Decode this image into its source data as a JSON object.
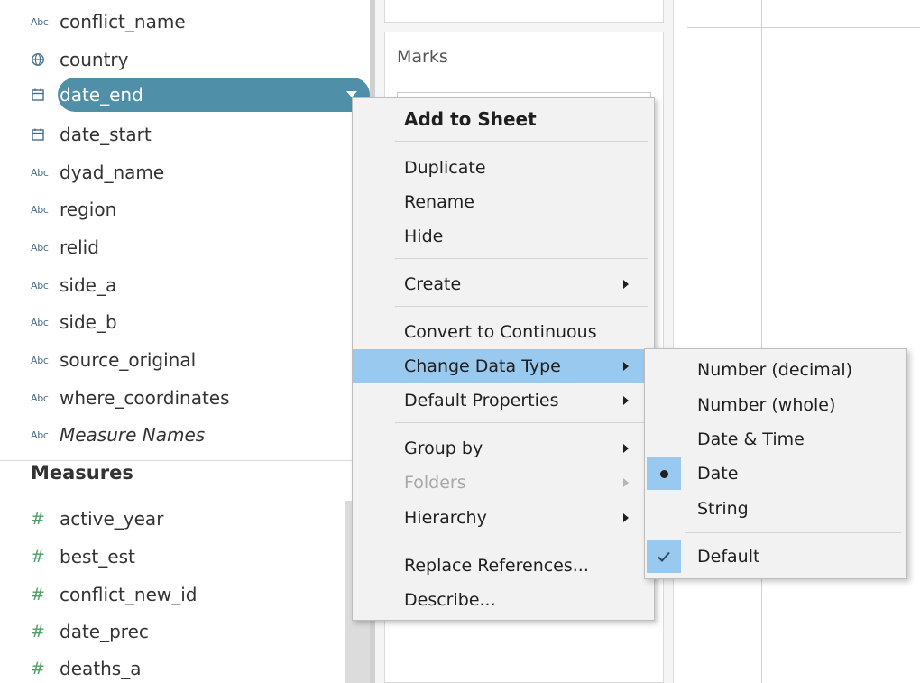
{
  "data_pane": {
    "dimensions": [
      {
        "icon": "abc-icon",
        "glyph": "Abc",
        "label": "conflict_name"
      },
      {
        "icon": "globe-icon",
        "glyph": "",
        "label": "country"
      },
      {
        "icon": "calendar-icon",
        "glyph": "",
        "label": "date_end",
        "selected": true
      },
      {
        "icon": "calendar-icon",
        "glyph": "",
        "label": "date_start"
      },
      {
        "icon": "abc-icon",
        "glyph": "Abc",
        "label": "dyad_name"
      },
      {
        "icon": "abc-icon",
        "glyph": "Abc",
        "label": "region"
      },
      {
        "icon": "abc-icon",
        "glyph": "Abc",
        "label": "relid"
      },
      {
        "icon": "abc-icon",
        "glyph": "Abc",
        "label": "side_a"
      },
      {
        "icon": "abc-icon",
        "glyph": "Abc",
        "label": "side_b"
      },
      {
        "icon": "abc-icon",
        "glyph": "Abc",
        "label": "source_original"
      },
      {
        "icon": "abc-icon",
        "glyph": "Abc",
        "label": "where_coordinates"
      },
      {
        "icon": "abc-icon",
        "glyph": "Abc",
        "label": "Measure Names",
        "italic": true
      }
    ],
    "measures_title": "Measures",
    "measures": [
      {
        "icon": "hash-icon",
        "glyph": "#",
        "label": "active_year"
      },
      {
        "icon": "hash-icon",
        "glyph": "#",
        "label": "best_est"
      },
      {
        "icon": "hash-icon",
        "glyph": "#",
        "label": "conflict_new_id"
      },
      {
        "icon": "hash-icon",
        "glyph": "#",
        "label": "date_prec"
      },
      {
        "icon": "hash-icon",
        "glyph": "#",
        "label": "deaths_a"
      }
    ]
  },
  "marks_card": {
    "title": "Marks"
  },
  "context_menu": {
    "add_to_sheet": "Add to Sheet",
    "duplicate": "Duplicate",
    "rename": "Rename",
    "hide": "Hide",
    "create": "Create",
    "convert_to_continuous": "Convert to Continuous",
    "change_data_type": "Change Data Type",
    "default_properties": "Default Properties",
    "group_by": "Group by",
    "folders": "Folders",
    "hierarchy": "Hierarchy",
    "replace_references": "Replace References...",
    "describe": "Describe..."
  },
  "data_type_submenu": {
    "number_decimal": "Number (decimal)",
    "number_whole": "Number (whole)",
    "date_time": "Date & Time",
    "date": "Date",
    "string": "String",
    "default": "Default",
    "selected_type": "Date"
  },
  "colors": {
    "selected_pill": "#4f8fa8",
    "menu_highlight": "#99c9ef",
    "dimension_icon": "#4a6d8c",
    "measure_icon": "#4f9e66"
  }
}
